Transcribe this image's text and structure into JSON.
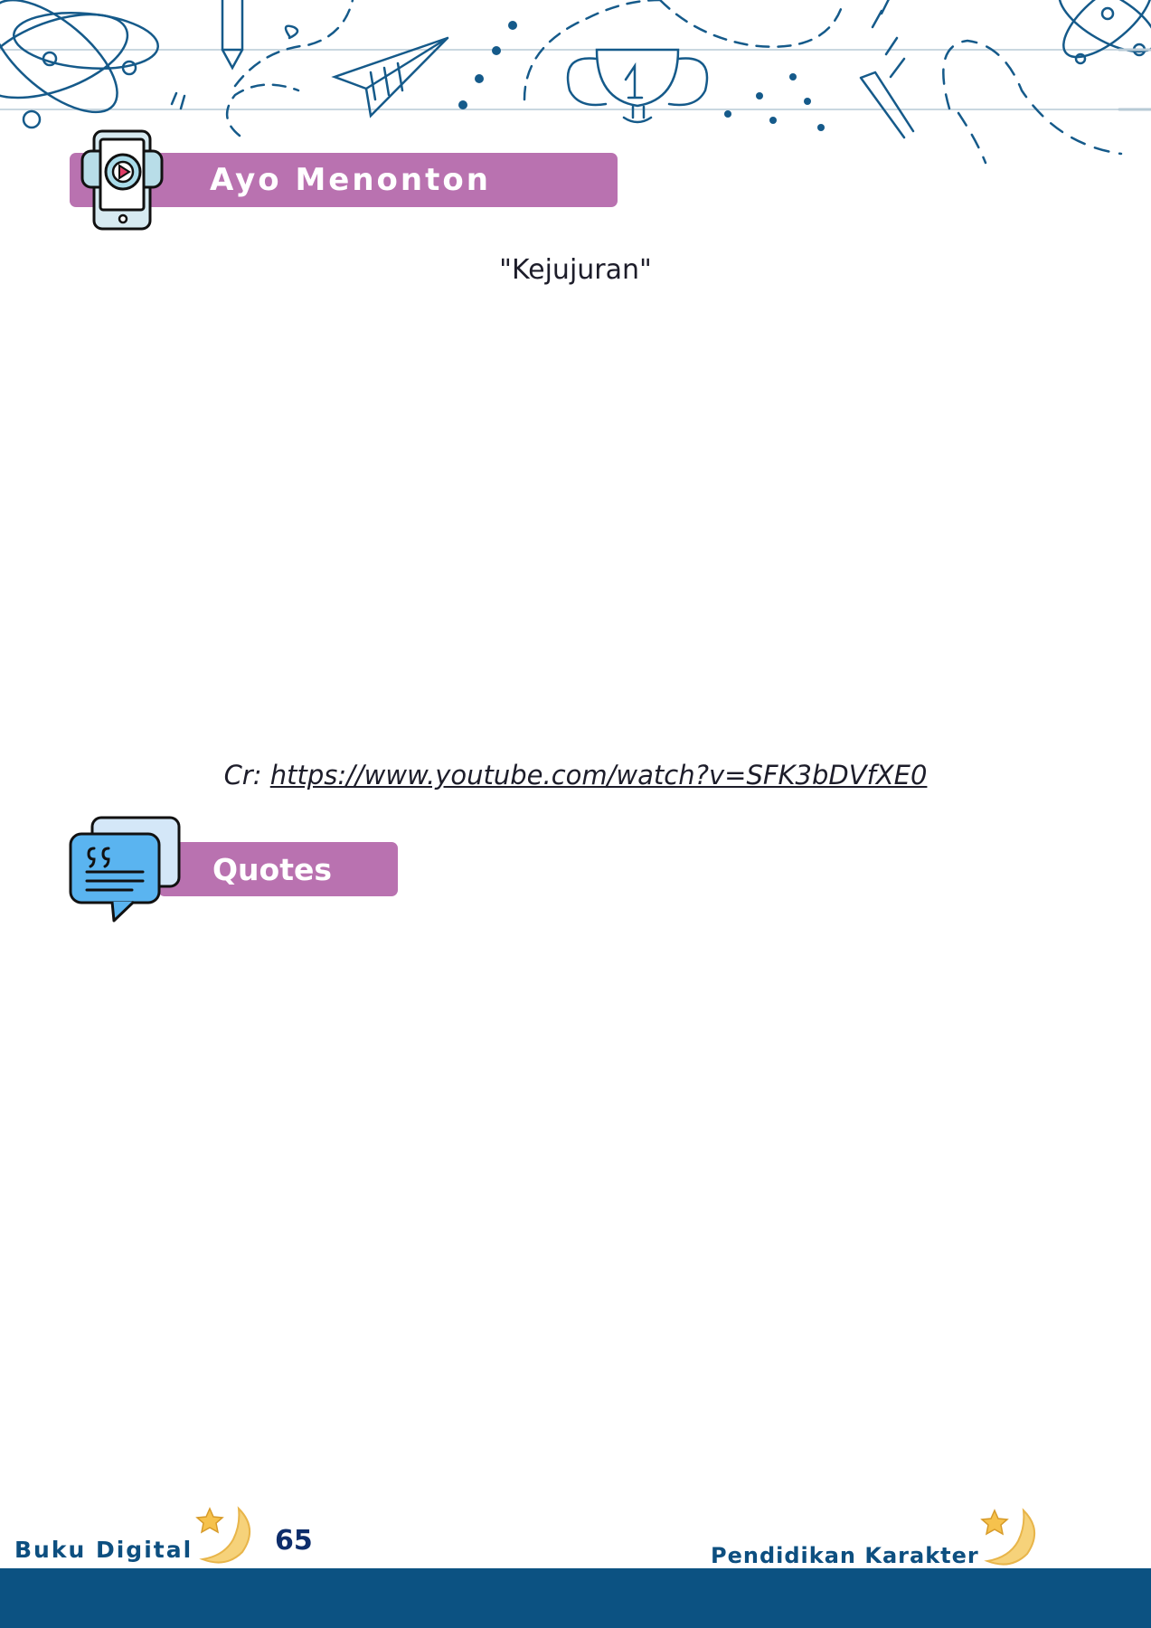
{
  "header": {
    "section_watch_label": "Ayo Menonton"
  },
  "video": {
    "title": "\"Kejujuran\"",
    "credit_prefix": "Cr:",
    "credit_url": "https://www.youtube.com/watch?v=SFK3bDVfXE0"
  },
  "quotes": {
    "section_label": "Quotes"
  },
  "footer": {
    "left_label": "Buku Digital",
    "page_number": "65",
    "right_label": "Pendidikan Karakter"
  },
  "colors": {
    "section_bar": "#b972b0",
    "footer_band": "#0c5282",
    "doodle_stroke": "#155a8a",
    "footer_text": "#0d4f80"
  },
  "icons": [
    "atom-icon",
    "pencil-icon",
    "paper-plane-icon",
    "trophy-icon",
    "phone-video-icon",
    "chat-quote-icon",
    "moon-star-icon"
  ]
}
